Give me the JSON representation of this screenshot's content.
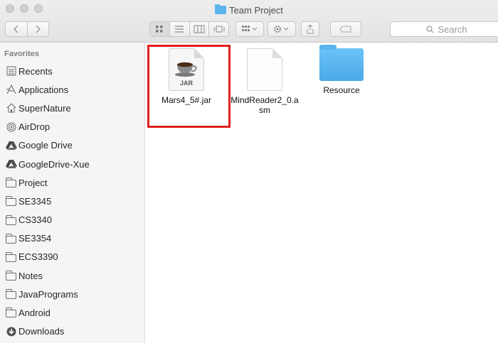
{
  "window": {
    "title": "Team Project",
    "toolbar": {
      "search_placeholder": "Search"
    }
  },
  "sidebar": {
    "heading": "Favorites",
    "items": [
      {
        "label": "Recents",
        "icon": "recents-icon"
      },
      {
        "label": "Applications",
        "icon": "applications-icon"
      },
      {
        "label": "SuperNature",
        "icon": "home-icon"
      },
      {
        "label": "AirDrop",
        "icon": "airdrop-icon"
      },
      {
        "label": "Google Drive",
        "icon": "google-drive-icon"
      },
      {
        "label": "GoogleDrive-Xue",
        "icon": "google-drive-icon"
      },
      {
        "label": "Project",
        "icon": "folder-icon"
      },
      {
        "label": "SE3345",
        "icon": "folder-icon"
      },
      {
        "label": "CS3340",
        "icon": "folder-icon"
      },
      {
        "label": "SE3354",
        "icon": "folder-icon"
      },
      {
        "label": "ECS3390",
        "icon": "folder-icon"
      },
      {
        "label": "Notes",
        "icon": "folder-icon"
      },
      {
        "label": "JavaPrograms",
        "icon": "folder-icon"
      },
      {
        "label": "Android",
        "icon": "folder-icon"
      },
      {
        "label": "Downloads",
        "icon": "downloads-icon"
      }
    ]
  },
  "files": [
    {
      "name": "Mars4_5#.jar",
      "kind": "jar",
      "badge": "JAR",
      "selected": true
    },
    {
      "name": "MindReader2_0.asm",
      "kind": "document",
      "selected": false
    },
    {
      "name": "Resource",
      "kind": "folder",
      "selected": false
    }
  ],
  "colors": {
    "selection_outline": "#e0201e",
    "folder_blue": "#5bb4ec"
  }
}
